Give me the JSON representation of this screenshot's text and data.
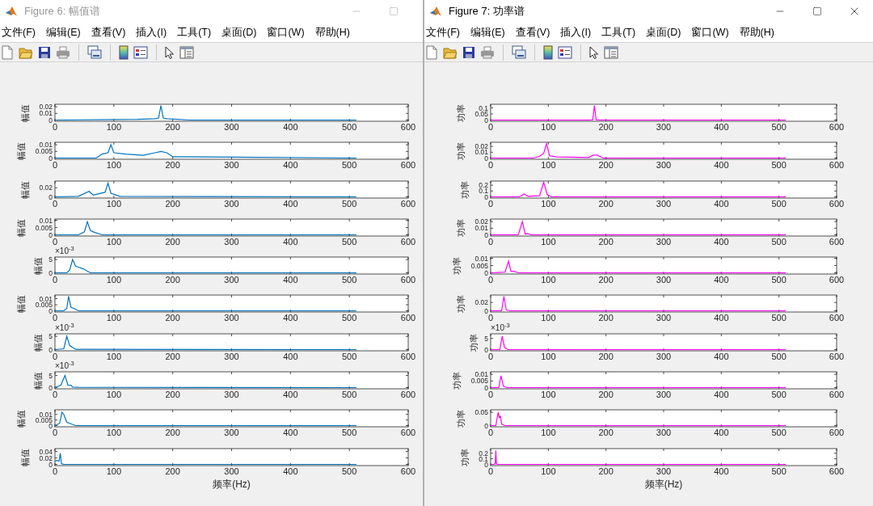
{
  "windows": [
    {
      "title": "Figure 6: 幅值谱",
      "active": false,
      "controls": [
        {
          "kind": "minimize"
        },
        {
          "kind": "maximize"
        }
      ],
      "menu": [
        "文件(F)",
        "编辑(E)",
        "查看(V)",
        "插入(I)",
        "工具(T)",
        "桌面(D)",
        "窗口(W)",
        "帮助(H)"
      ],
      "toolbar": [
        {
          "kind": "new"
        },
        {
          "kind": "open"
        },
        {
          "kind": "save"
        },
        {
          "kind": "print"
        },
        {
          "kind": "separator"
        },
        {
          "kind": "link"
        },
        {
          "kind": "separator"
        },
        {
          "kind": "colorbar"
        },
        {
          "kind": "legend"
        },
        {
          "kind": "separator"
        },
        {
          "kind": "pointer"
        },
        {
          "kind": "property"
        }
      ],
      "subplots": [
        {
          "chart_data": {
            "type": "line",
            "ylabel": "幅值",
            "x": [
              0,
              140,
              170,
              176,
              180,
              184,
              190,
              230,
              512
            ],
            "series": [
              {
                "color": "#0072bd",
                "values": [
                  0,
                  0.001,
                  0.002,
                  0.003,
                  0.022,
                  0.003,
                  0.002,
                  0,
                  0
                ]
              }
            ],
            "xlim": [
              0,
              600
            ],
            "ylim": [
              0,
              0.022
            ],
            "xticks": [
              0,
              100,
              200,
              300,
              400,
              500,
              600
            ],
            "yticks": [
              0,
              0.01,
              0.02
            ]
          }
        },
        {
          "chart_data": {
            "type": "line",
            "ylabel": "幅值",
            "x": [
              0,
              70,
              80,
              90,
              95,
              100,
              120,
              150,
              170,
              180,
              190,
              200,
              512
            ],
            "series": [
              {
                "color": "#0072bd",
                "values": [
                  0,
                  0,
                  0.003,
                  0.004,
                  0.01,
                  0.004,
                  0.003,
                  0.002,
                  0.004,
                  0.005,
                  0.004,
                  0.001,
                  0
                ]
              }
            ],
            "xlim": [
              0,
              600
            ],
            "ylim": [
              0,
              0.011
            ],
            "xticks": [
              0,
              100,
              200,
              300,
              400,
              500,
              600
            ],
            "yticks": [
              0,
              0.005,
              0.01
            ]
          }
        },
        {
          "chart_data": {
            "type": "line",
            "ylabel": "幅值",
            "x": [
              0,
              40,
              58,
              65,
              85,
              90,
              95,
              110,
              512
            ],
            "series": [
              {
                "color": "#0072bd",
                "values": [
                  0,
                  0.001,
                  0.012,
                  0.004,
                  0.01,
                  0.03,
                  0.008,
                  0.001,
                  0
                ]
              }
            ],
            "xlim": [
              0,
              600
            ],
            "ylim": [
              0,
              0.032
            ],
            "xticks": [
              0,
              100,
              200,
              300,
              400,
              500,
              600
            ],
            "yticks": [
              0,
              0.02
            ]
          }
        },
        {
          "chart_data": {
            "type": "line",
            "ylabel": "幅值",
            "x": [
              0,
              40,
              50,
              55,
              60,
              65,
              80,
              512
            ],
            "series": [
              {
                "color": "#0072bd",
                "values": [
                  0,
                  0,
                  0.002,
                  0.009,
                  0.003,
                  0.002,
                  0,
                  0
                ]
              }
            ],
            "xlim": [
              0,
              600
            ],
            "ylim": [
              0,
              0.01
            ],
            "xticks": [
              0,
              100,
              200,
              300,
              400,
              500,
              600
            ],
            "yticks": [
              0,
              0.005,
              0.01
            ]
          }
        },
        {
          "exponent": "×10$^{-3}$",
          "chart_data": {
            "type": "line",
            "ylabel": "幅值",
            "x": [
              0,
              20,
              25,
              30,
              35,
              42,
              48,
              60,
              512
            ],
            "series": [
              {
                "color": "#0072bd",
                "values": [
                  0,
                  0,
                  1,
                  5,
                  2.5,
                  2,
                  1.5,
                  0,
                  0
                ]
              }
            ],
            "xlim": [
              0,
              600
            ],
            "ylim": [
              0,
              5.5
            ],
            "xticks": [
              0,
              100,
              200,
              300,
              400,
              500,
              600
            ],
            "yticks": [
              0,
              5
            ]
          }
        },
        {
          "chart_data": {
            "type": "line",
            "ylabel": "幅值",
            "x": [
              0,
              15,
              20,
              23,
              27,
              32,
              40,
              512
            ],
            "series": [
              {
                "color": "#0072bd",
                "values": [
                  0,
                  0,
                  0.002,
                  0.012,
                  0.003,
                  0.002,
                  0,
                  0
                ]
              }
            ],
            "xlim": [
              0,
              600
            ],
            "ylim": [
              0,
              0.012
            ],
            "xticks": [
              0,
              100,
              200,
              300,
              400,
              500,
              600
            ],
            "yticks": [
              0,
              0.005,
              0.01
            ]
          }
        },
        {
          "exponent": "×10$^{-3}$",
          "chart_data": {
            "type": "line",
            "ylabel": "幅值",
            "x": [
              0,
              15,
              20,
              25,
              35,
              512
            ],
            "series": [
              {
                "color": "#0072bd",
                "values": [
                  0,
                  0.3,
                  5,
                  1.5,
                  0.1,
                  0
                ]
              }
            ],
            "xlim": [
              0,
              600
            ],
            "ylim": [
              0,
              5.5
            ],
            "xticks": [
              0,
              100,
              200,
              300,
              400,
              500,
              600
            ],
            "yticks": [
              0,
              5
            ]
          }
        },
        {
          "exponent": "×10$^{-3}$",
          "chart_data": {
            "type": "line",
            "ylabel": "幅值",
            "x": [
              0,
              10,
              17,
              22,
              27,
              30,
              40,
              512
            ],
            "series": [
              {
                "color": "#0072bd",
                "values": [
                  0,
                  1,
                  5,
                  1,
                  1,
                  0.2,
                  0.1,
                  0
                ]
              }
            ],
            "xlim": [
              0,
              600
            ],
            "ylim": [
              0,
              6
            ],
            "xticks": [
              0,
              100,
              200,
              300,
              400,
              500,
              600
            ],
            "yticks": [
              0,
              5
            ]
          }
        },
        {
          "chart_data": {
            "type": "line",
            "ylabel": "幅值",
            "x": [
              0,
              8,
              12,
              15,
              20,
              25,
              35,
              512
            ],
            "series": [
              {
                "color": "#0072bd",
                "values": [
                  0,
                  0.002,
                  0.012,
                  0.01,
                  0.003,
                  0.002,
                  0,
                  0
                ]
              }
            ],
            "xlim": [
              0,
              600
            ],
            "ylim": [
              0,
              0.013
            ],
            "xticks": [
              0,
              100,
              200,
              300,
              400,
              500,
              600
            ],
            "yticks": [
              0,
              0.005,
              0.01
            ]
          }
        },
        {
          "chart_data": {
            "type": "line",
            "xlabel": "频率(Hz)",
            "ylabel": "幅值",
            "x": [
              0,
              3,
              7,
              9,
              11,
              15,
              512
            ],
            "series": [
              {
                "color": "#0072bd",
                "values": [
                  0.01,
                  0.012,
                  0.01,
                  0.035,
                  0.002,
                  0,
                  0
                ]
              }
            ],
            "xlim": [
              0,
              600
            ],
            "ylim": [
              0,
              0.045
            ],
            "xticks": [
              0,
              100,
              200,
              300,
              400,
              500,
              600
            ],
            "yticks": [
              0,
              0.02,
              0.04
            ]
          }
        }
      ]
    },
    {
      "title": "Figure 7: 功率谱",
      "active": true,
      "controls": [
        {
          "kind": "minimize"
        },
        {
          "kind": "maximize"
        },
        {
          "kind": "close"
        }
      ],
      "menu": [
        "文件(F)",
        "编辑(E)",
        "查看(V)",
        "插入(I)",
        "工具(T)",
        "桌面(D)",
        "窗口(W)",
        "帮助(H)"
      ],
      "toolbar": [
        {
          "kind": "new"
        },
        {
          "kind": "open"
        },
        {
          "kind": "save"
        },
        {
          "kind": "print"
        },
        {
          "kind": "separator"
        },
        {
          "kind": "link"
        },
        {
          "kind": "separator"
        },
        {
          "kind": "colorbar"
        },
        {
          "kind": "legend"
        },
        {
          "kind": "separator"
        },
        {
          "kind": "pointer"
        },
        {
          "kind": "property"
        }
      ],
      "subplots": [
        {
          "chart_data": {
            "type": "line",
            "ylabel": "功率",
            "x": [
              0,
              170,
              177,
              180,
              183,
              190,
              512
            ],
            "series": [
              {
                "color": "#ff00ff",
                "values": [
                  0,
                  0,
                  0.002,
                  0.12,
                  0.002,
                  0,
                  0
                ]
              }
            ],
            "xlim": [
              0,
              600
            ],
            "ylim": [
              0,
              0.12
            ],
            "xticks": [
              0,
              100,
              200,
              300,
              400,
              500,
              600
            ],
            "yticks": [
              0,
              0.05,
              0.1
            ]
          }
        },
        {
          "chart_data": {
            "type": "line",
            "ylabel": "功率",
            "x": [
              0,
              75,
              85,
              92,
              97,
              102,
              115,
              170,
              178,
              185,
              195,
              512
            ],
            "series": [
              {
                "color": "#ff00ff",
                "values": [
                  0,
                  0,
                  0.003,
                  0.008,
                  0.025,
                  0.004,
                  0.002,
                  0.001,
                  0.005,
                  0.005,
                  0,
                  0
                ]
              }
            ],
            "xlim": [
              0,
              600
            ],
            "ylim": [
              0,
              0.025
            ],
            "xticks": [
              0,
              100,
              200,
              300,
              400,
              500,
              600
            ],
            "yticks": [
              0,
              0.01,
              0.02
            ]
          }
        },
        {
          "chart_data": {
            "type": "line",
            "ylabel": "功率",
            "x": [
              0,
              50,
              58,
              65,
              85,
              92,
              98,
              105,
              512
            ],
            "series": [
              {
                "color": "#ff00ff",
                "values": [
                  0,
                  0,
                  0.05,
                  0.01,
                  0.02,
                  0.25,
                  0.04,
                  0,
                  0
                ]
              }
            ],
            "xlim": [
              0,
              600
            ],
            "ylim": [
              0,
              0.25
            ],
            "xticks": [
              0,
              100,
              200,
              300,
              400,
              500,
              600
            ],
            "yticks": [
              0,
              0.1,
              0.2
            ]
          }
        },
        {
          "chart_data": {
            "type": "line",
            "ylabel": "功率",
            "x": [
              0,
              48,
              55,
              60,
              64,
              70,
              512
            ],
            "series": [
              {
                "color": "#ff00ff",
                "values": [
                  0,
                  0,
                  0.02,
                  0.001,
                  0.002,
                  0,
                  0
                ]
              }
            ],
            "xlim": [
              0,
              600
            ],
            "ylim": [
              0,
              0.022
            ],
            "xticks": [
              0,
              100,
              200,
              300,
              400,
              500,
              600
            ],
            "yticks": [
              0,
              0.01,
              0.02
            ]
          }
        },
        {
          "chart_data": {
            "type": "line",
            "ylabel": "功率",
            "x": [
              0,
              25,
              31,
              35,
              40,
              48,
              512
            ],
            "series": [
              {
                "color": "#ff00ff",
                "values": [
                  0,
                  0.0005,
                  0.008,
                  0.001,
                  0.001,
                  0,
                  0
                ]
              }
            ],
            "xlim": [
              0,
              600
            ],
            "ylim": [
              0,
              0.01
            ],
            "xticks": [
              0,
              100,
              200,
              300,
              400,
              500,
              600
            ],
            "yticks": [
              0,
              0.005,
              0.01
            ]
          }
        },
        {
          "chart_data": {
            "type": "line",
            "ylabel": "功率",
            "x": [
              0,
              19,
              23,
              27,
              35,
              512
            ],
            "series": [
              {
                "color": "#ff00ff",
                "values": [
                  0,
                  0,
                  0.035,
                  0.002,
                  0,
                  0
                ]
              }
            ],
            "xlim": [
              0,
              600
            ],
            "ylim": [
              0,
              0.035
            ],
            "xticks": [
              0,
              100,
              200,
              300,
              400,
              500,
              600
            ],
            "yticks": [
              0,
              0.02
            ]
          }
        },
        {
          "exponent": "×10$^{-3}$",
          "chart_data": {
            "type": "line",
            "ylabel": "功率",
            "x": [
              0,
              16,
              20,
              24,
              30,
              512
            ],
            "series": [
              {
                "color": "#ff00ff",
                "values": [
                  0,
                  0,
                  6,
                  1,
                  0,
                  0
                ]
              }
            ],
            "xlim": [
              0,
              600
            ],
            "ylim": [
              0,
              6.5
            ],
            "xticks": [
              0,
              100,
              200,
              300,
              400,
              500,
              600
            ],
            "yticks": [
              0,
              5
            ]
          }
        },
        {
          "chart_data": {
            "type": "line",
            "ylabel": "功率",
            "x": [
              0,
              14,
              18,
              22,
              28,
              512
            ],
            "series": [
              {
                "color": "#ff00ff",
                "values": [
                  0,
                  0,
                  0.009,
                  0.001,
                  0,
                  0
                ]
              }
            ],
            "xlim": [
              0,
              600
            ],
            "ylim": [
              0,
              0.011
            ],
            "xticks": [
              0,
              100,
              200,
              300,
              400,
              500,
              600
            ],
            "yticks": [
              0,
              0.005,
              0.01
            ]
          }
        },
        {
          "chart_data": {
            "type": "line",
            "ylabel": "功率",
            "x": [
              0,
              9,
              13,
              15,
              17,
              19,
              25,
              512
            ],
            "series": [
              {
                "color": "#ff00ff",
                "values": [
                  0,
                  0,
                  0.05,
                  0.03,
                  0.035,
                  0.005,
                  0,
                  0
                ]
              }
            ],
            "xlim": [
              0,
              600
            ],
            "ylim": [
              0,
              0.055
            ],
            "xticks": [
              0,
              100,
              200,
              300,
              400,
              500,
              600
            ],
            "yticks": [
              0,
              0.05
            ]
          }
        },
        {
          "chart_data": {
            "type": "line",
            "xlabel": "频率(Hz)",
            "ylabel": "功率",
            "x": [
              0,
              6,
              8,
              9,
              10,
              12,
              512
            ],
            "series": [
              {
                "color": "#ff00ff",
                "values": [
                  0,
                  0,
                  0.02,
                  0.25,
                  0.01,
                  0,
                  0
                ]
              }
            ],
            "xlim": [
              0,
              600
            ],
            "ylim": [
              0,
              0.26
            ],
            "xticks": [
              0,
              100,
              200,
              300,
              400,
              500,
              600
            ],
            "yticks": [
              0,
              0.1,
              0.2
            ]
          }
        }
      ]
    }
  ]
}
